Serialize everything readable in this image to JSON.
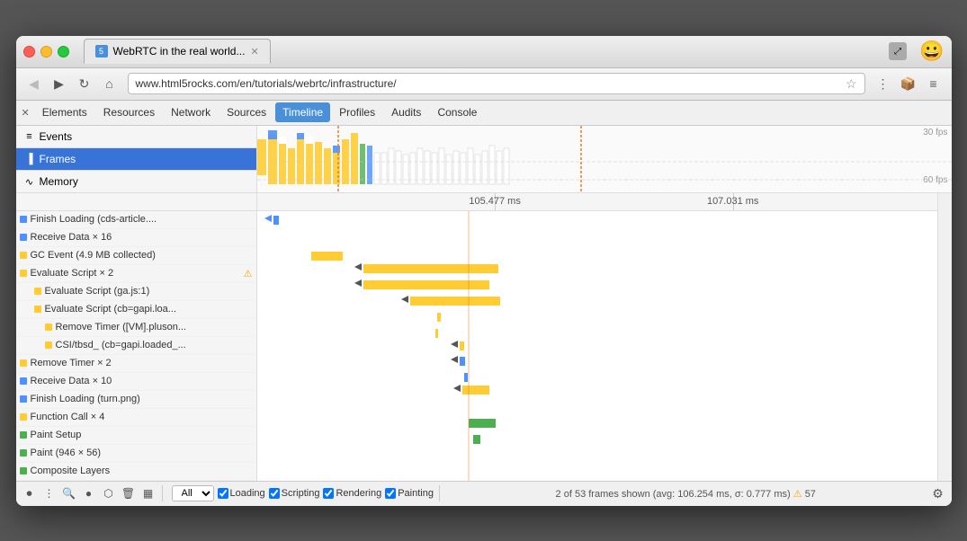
{
  "browser": {
    "tab_title": "WebRTC in the real world...",
    "url_prefix": "www.html5rocks.com",
    "url_path": "/en/tutorials/webrtc/infrastructure/",
    "emoji": "😀"
  },
  "devtools": {
    "menu_items": [
      "Elements",
      "Resources",
      "Network",
      "Sources",
      "Timeline",
      "Profiles",
      "Audits",
      "Console"
    ],
    "active_menu": "Timeline"
  },
  "sidebar": {
    "items": [
      {
        "id": "events",
        "label": "Events",
        "icon": "≡"
      },
      {
        "id": "frames",
        "label": "Frames",
        "icon": "▐",
        "selected": true
      },
      {
        "id": "memory",
        "label": "Memory",
        "icon": "~"
      }
    ]
  },
  "timeline": {
    "timestamps": [
      "105.477 ms",
      "107.031 ms"
    ],
    "fps_labels": [
      "30 fps",
      "60 fps"
    ]
  },
  "events": [
    {
      "label": "Finish Loading (cds-article....",
      "color": "#4d90fe",
      "indent": 0
    },
    {
      "label": "Receive Data × 16",
      "color": "#4d90fe",
      "indent": 0
    },
    {
      "label": "GC Event (4.9 MB collected)",
      "color": "#ffcc33",
      "indent": 0
    },
    {
      "label": "Evaluate Script × 2",
      "color": "#ffcc33",
      "indent": 0,
      "warning": true
    },
    {
      "label": "Evaluate Script (ga.js:1)",
      "color": "#ffcc33",
      "indent": 1
    },
    {
      "label": "Evaluate Script (cb=gapi.loa...",
      "color": "#ffcc33",
      "indent": 1
    },
    {
      "label": "Remove Timer ([VM].pluson...",
      "color": "#ffcc33",
      "indent": 2
    },
    {
      "label": "CSI/tbsd_ (cb=gapi.loaded_...",
      "color": "#ffcc33",
      "indent": 2
    },
    {
      "label": "Remove Timer × 2",
      "color": "#ffcc33",
      "indent": 0
    },
    {
      "label": "Receive Data × 10",
      "color": "#4d90fe",
      "indent": 0
    },
    {
      "label": "Finish Loading (turn.png)",
      "color": "#4d90fe",
      "indent": 0
    },
    {
      "label": "Function Call × 4",
      "color": "#ffcc33",
      "indent": 0
    },
    {
      "label": "Paint Setup",
      "color": "#4caf50",
      "indent": 0
    },
    {
      "label": "Paint (946 × 56)",
      "color": "#4caf50",
      "indent": 0
    },
    {
      "label": "Composite Layers",
      "color": "#4caf50",
      "indent": 0
    }
  ],
  "status_bar": {
    "filter_label": "All",
    "loading_label": "Loading",
    "scripting_label": "Scripting",
    "rendering_label": "Rendering",
    "painting_label": "Painting",
    "frames_info": "2 of 53 frames shown (avg: 106.254 ms, σ: 0.777 ms)",
    "frames_count": "57"
  },
  "colors": {
    "blue": "#4d90fe",
    "yellow": "#ffcc33",
    "green": "#4caf50",
    "purple": "#9c5fb5",
    "selected": "#3874d8",
    "timeline_marker": "#e67e22"
  }
}
